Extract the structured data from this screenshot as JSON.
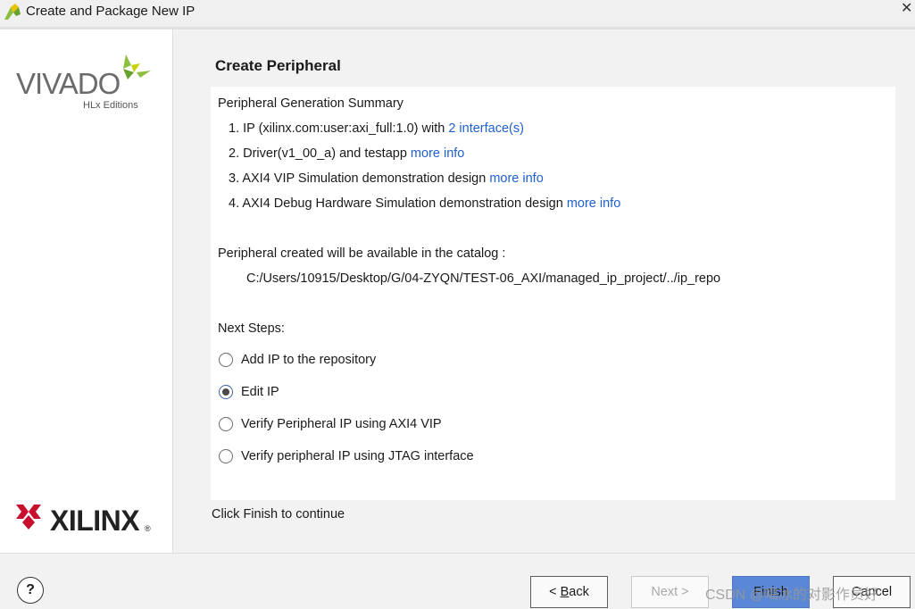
{
  "window": {
    "title": "Create and Package New IP",
    "close_glyph": "✕"
  },
  "sidebar": {
    "vivado_logo_text": "VIVADO",
    "vivado_edition": "HLx Editions",
    "xilinx_logo_text": "XILINX",
    "xilinx_registered": "®"
  },
  "main": {
    "title": "Create Peripheral",
    "summary_heading": "Peripheral Generation Summary",
    "summary_items": [
      {
        "text": "1. IP (xilinx.com:user:axi_full:1.0) with ",
        "link": "2 interface(s)"
      },
      {
        "text": "2. Driver(v1_00_a) and testapp ",
        "link": "more info"
      },
      {
        "text": "3. AXI4 VIP Simulation demonstration design ",
        "link": "more info"
      },
      {
        "text": "4. AXI4 Debug Hardware Simulation demonstration design ",
        "link": "more info"
      }
    ],
    "catalog_text": "Peripheral created will be available in the catalog :",
    "catalog_path": "C:/Users/10915/Desktop/G/04-ZYQN/TEST-06_AXI/managed_ip_project/../ip_repo",
    "next_steps_label": "Next Steps:",
    "options": [
      {
        "label": "Add IP to the repository",
        "selected": false
      },
      {
        "label": "Edit IP",
        "selected": true
      },
      {
        "label": "Verify Peripheral IP using AXI4 VIP",
        "selected": false
      },
      {
        "label": "Verify peripheral IP using JTAG interface",
        "selected": false
      }
    ],
    "footer_text": "Click Finish to continue"
  },
  "buttons": {
    "help": "?",
    "back_mnemonic": "B",
    "back_rest": "ack",
    "back_prefix": "< ",
    "next": "Next >",
    "finish": "Finish",
    "cancel": "Cancel"
  },
  "watermark": "CSDN @喝冰的对影作员好",
  "colors": {
    "link": "#1f5fcf",
    "primary_button": "#5b88d6",
    "xilinx_red": "#c8102e",
    "vivado_green": "#8dbf3f"
  }
}
